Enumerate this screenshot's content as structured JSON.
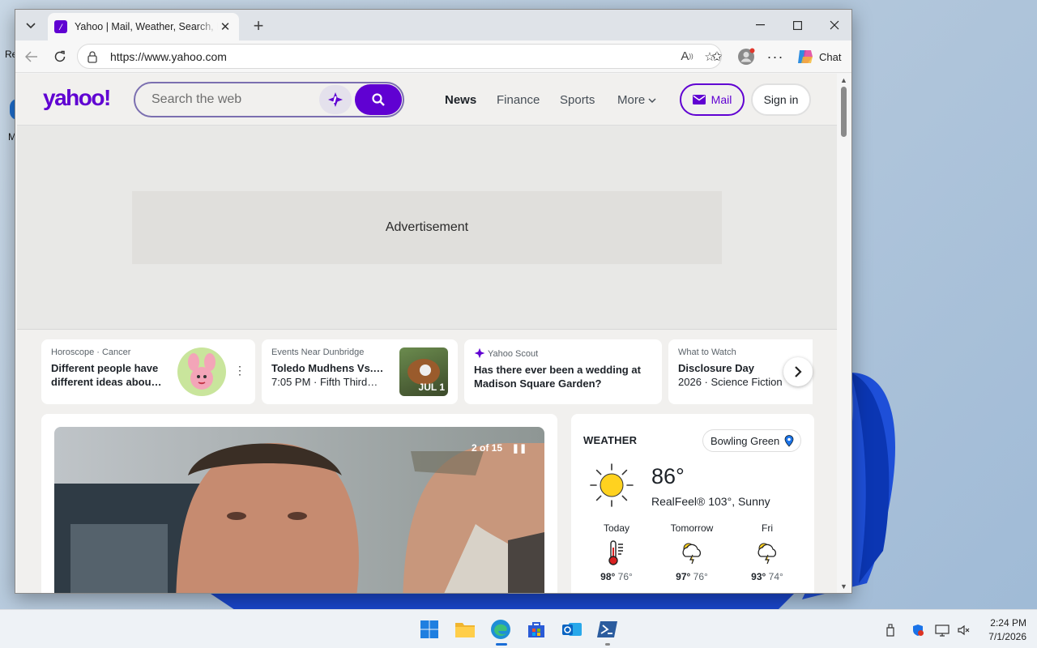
{
  "browser": {
    "tab_title": "Yahoo | Mail, Weather, Search, Politics, News, Finance, Sports & Videos",
    "url": "https://www.yahoo.com",
    "chat_label": "Chat"
  },
  "yahoo": {
    "logo": "yahoo!",
    "search_placeholder": "Search the web",
    "nav": [
      "News",
      "Finance",
      "Sports",
      "More"
    ],
    "mail_label": "Mail",
    "signin_label": "Sign in",
    "brand_color": "#6001d2"
  },
  "ad": {
    "label": "Advertisement"
  },
  "cards": [
    {
      "category": "Horoscope",
      "category2": "Cancer",
      "headline": "Different people have different ideas abou…"
    },
    {
      "category": "Events Near Dunbridge",
      "headline": "Toledo Mudhens Vs.…",
      "sub": "7:05 PM · Fifth Third…",
      "badge": "JUL 1"
    },
    {
      "category": "Yahoo Scout",
      "headline": "Has there ever been a wedding at Madison Square Garden?"
    },
    {
      "category": "What to Watch",
      "headline": "Disclosure Day",
      "sub": "2026 · Science Fiction"
    }
  ],
  "hero": {
    "counter": "2 of 15"
  },
  "weather": {
    "title": "WEATHER",
    "location": "Bowling Green",
    "temp": "86°",
    "realfeel": "RealFeel® 103°, Sunny",
    "forecast": [
      {
        "day": "Today",
        "high": "98°",
        "low": "76°",
        "icon": "thermometer-icon"
      },
      {
        "day": "Tomorrow",
        "high": "97°",
        "low": "76°",
        "icon": "thunderstorm-sun-icon"
      },
      {
        "day": "Fri",
        "high": "93°",
        "low": "74°",
        "icon": "thunderstorm-sun-icon"
      }
    ]
  },
  "taskbar": {
    "time": "2:24 PM",
    "date": "7/1/2026"
  }
}
